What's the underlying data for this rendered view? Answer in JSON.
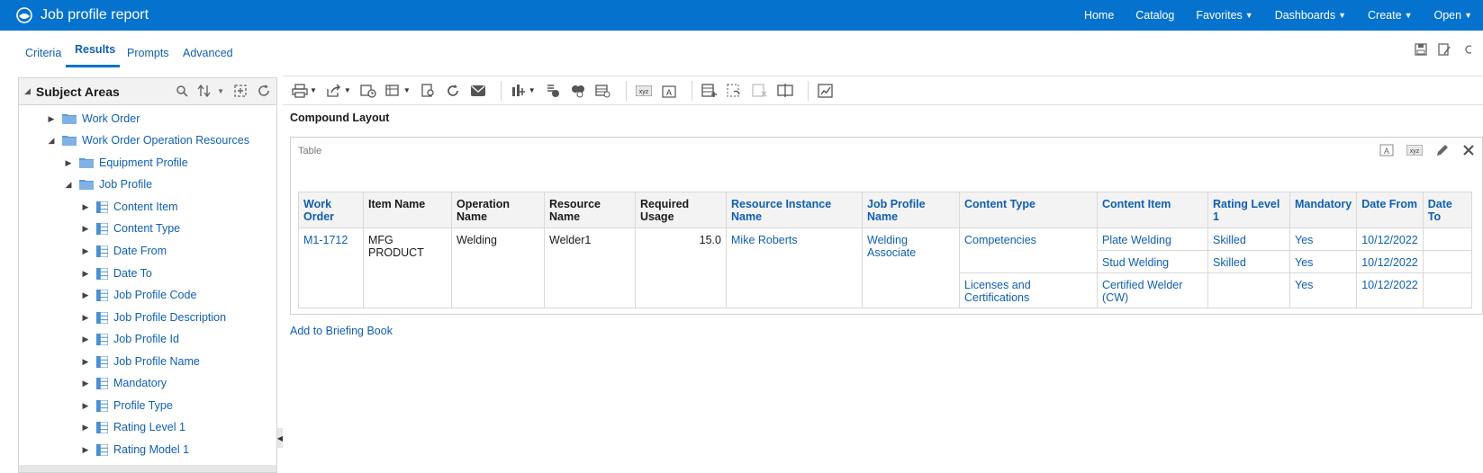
{
  "header": {
    "title": "Job profile report",
    "nav": [
      {
        "label": "Home",
        "dropdown": false
      },
      {
        "label": "Catalog",
        "dropdown": false
      },
      {
        "label": "Favorites",
        "dropdown": true
      },
      {
        "label": "Dashboards",
        "dropdown": true
      },
      {
        "label": "Create",
        "dropdown": true
      },
      {
        "label": "Open",
        "dropdown": true
      }
    ]
  },
  "tabs": {
    "criteria": "Criteria",
    "results": "Results",
    "prompts": "Prompts",
    "advanced": "Advanced"
  },
  "subject_areas": {
    "title": "Subject Areas",
    "tree": [
      {
        "label": "Work Order",
        "kind": "folder",
        "expanded": false
      },
      {
        "label": "Work Order Operation Resources",
        "kind": "folder",
        "expanded": true
      },
      {
        "label": "Equipment Profile",
        "kind": "folder",
        "expanded": false
      },
      {
        "label": "Job Profile",
        "kind": "folder",
        "expanded": true
      },
      {
        "label": "Content Item",
        "kind": "column"
      },
      {
        "label": "Content Type",
        "kind": "column"
      },
      {
        "label": "Date From",
        "kind": "column"
      },
      {
        "label": "Date To",
        "kind": "column"
      },
      {
        "label": "Job Profile Code",
        "kind": "column"
      },
      {
        "label": "Job Profile Description",
        "kind": "column"
      },
      {
        "label": "Job Profile Id",
        "kind": "column"
      },
      {
        "label": "Job Profile Name",
        "kind": "column"
      },
      {
        "label": "Mandatory",
        "kind": "column"
      },
      {
        "label": "Profile Type",
        "kind": "column"
      },
      {
        "label": "Rating Level 1",
        "kind": "column"
      },
      {
        "label": "Rating Model 1",
        "kind": "column"
      }
    ]
  },
  "compound_layout": {
    "title": "Compound Layout",
    "view_label": "Table"
  },
  "table": {
    "headers": {
      "work_order": "Work Order",
      "item_name": "Item Name",
      "operation_name": "Operation Name",
      "resource_name": "Resource Name",
      "required_usage": "Required Usage",
      "resource_instance_name": "Resource Instance Name",
      "job_profile_name": "Job Profile Name",
      "content_type": "Content Type",
      "content_item": "Content Item",
      "rating_level_1": "Rating Level 1",
      "mandatory": "Mandatory",
      "date_from": "Date From",
      "date_to": "Date To"
    },
    "group": {
      "work_order": "M1-1712",
      "item_name": "MFG PRODUCT",
      "operation_name": "Welding",
      "resource_name": "Welder1",
      "required_usage": "15.0",
      "resource_instance_name": "Mike Roberts",
      "job_profile_name": "Welding Associate"
    },
    "content_types": [
      {
        "name": "Competencies",
        "items": [
          {
            "content_item": "Plate Welding",
            "rating_level_1": "Skilled",
            "mandatory": "Yes",
            "date_from": "10/12/2022",
            "date_to": ""
          },
          {
            "content_item": "Stud Welding",
            "rating_level_1": "Skilled",
            "mandatory": "Yes",
            "date_from": "10/12/2022",
            "date_to": ""
          }
        ]
      },
      {
        "name": "Licenses and Certifications",
        "items": [
          {
            "content_item": "Certified Welder (CW)",
            "rating_level_1": "",
            "mandatory": "Yes",
            "date_from": "10/12/2022",
            "date_to": ""
          }
        ]
      }
    ]
  },
  "briefing_link": "Add to Briefing Book",
  "colors": {
    "brand": "#0572ce",
    "link": "#0f5fb3",
    "header_bg": "#f3f3f3"
  }
}
